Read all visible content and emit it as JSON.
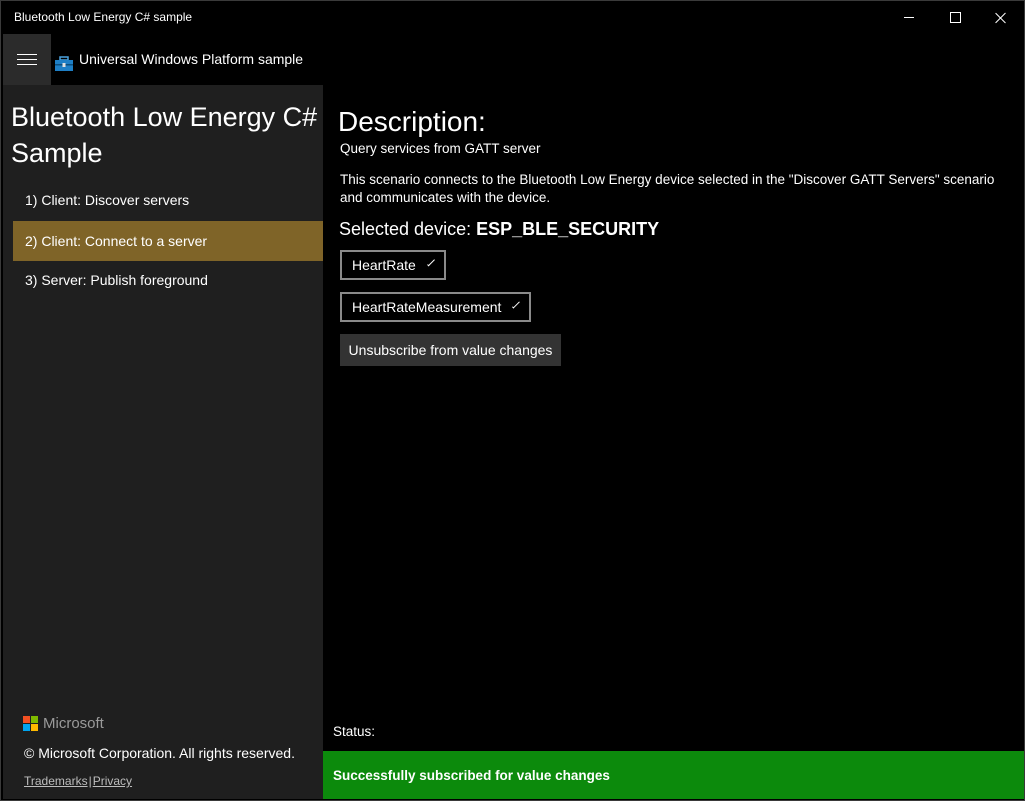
{
  "window": {
    "title": "Bluetooth Low Energy C# sample"
  },
  "header": {
    "app_title": "Universal Windows Platform sample",
    "menu_icon": "hamburger-icon",
    "app_icon": "toolbox-icon"
  },
  "sidebar": {
    "title": "Bluetooth Low Energy C# Sample",
    "items": [
      {
        "label": "1) Client: Discover servers",
        "selected": false
      },
      {
        "label": "2) Client: Connect to a server",
        "selected": true
      },
      {
        "label": "3) Server: Publish foreground",
        "selected": false
      }
    ],
    "footer": {
      "brand": "Microsoft",
      "copyright": "© Microsoft Corporation. All rights reserved.",
      "trademarks": "Trademarks",
      "separator": "|",
      "privacy": "Privacy"
    }
  },
  "main": {
    "heading": "Description:",
    "subtitle": "Query services from GATT server",
    "body": "This scenario connects to the Bluetooth Low Energy device selected in the \"Discover GATT Servers\" scenario and communicates with the device.",
    "selected_device_label": "Selected device:",
    "selected_device_name": "ESP_BLE_SECURITY",
    "service_combo": {
      "selected": "HeartRate"
    },
    "characteristic_combo": {
      "selected": "HeartRateMeasurement"
    },
    "unsubscribe_button": "Unsubscribe from value changes"
  },
  "status": {
    "label": "Status:",
    "message": "Successfully subscribed for value changes"
  },
  "colors": {
    "selected_nav": "#7f6428",
    "status_success": "#0c8a0c",
    "sidebar_bg": "#1f1f1f"
  }
}
